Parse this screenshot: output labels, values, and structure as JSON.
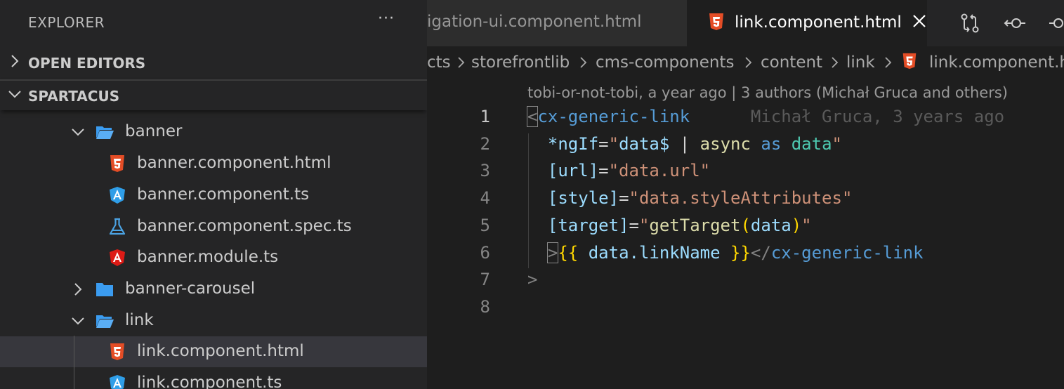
{
  "sidebar": {
    "title": "EXPLORER",
    "more": "···",
    "sections": {
      "open_editors": "OPEN EDITORS",
      "workspace": "SPARTACUS"
    },
    "tree": [
      {
        "label": "banner",
        "kind": "folder",
        "expanded": true
      },
      {
        "label": "banner.component.html",
        "kind": "html"
      },
      {
        "label": "banner.component.ts",
        "kind": "angular-component"
      },
      {
        "label": "banner.component.spec.ts",
        "kind": "test"
      },
      {
        "label": "banner.module.ts",
        "kind": "angular-module"
      },
      {
        "label": "banner-carousel",
        "kind": "folder",
        "expanded": false
      },
      {
        "label": "link",
        "kind": "folder",
        "expanded": true
      },
      {
        "label": "link.component.html",
        "kind": "html",
        "selected": true
      },
      {
        "label": "link.component.ts",
        "kind": "angular-component"
      }
    ]
  },
  "editor": {
    "tabs": [
      {
        "label": "igation-ui.component.html",
        "active": false
      },
      {
        "label": "link.component.html",
        "active": true
      }
    ],
    "tab_actions": [
      "open-changes-icon",
      "go-back-icon",
      "go-forward-icon"
    ],
    "breadcrumb": [
      "cts",
      "storefrontlib",
      "cms-components",
      "content",
      "link",
      "link.component.h"
    ],
    "codelens": "tobi-or-not-tobi, a year ago | 3 authors (Michał Gruca and others)",
    "line_numbers": [
      "1",
      "2",
      "3",
      "4",
      "5",
      "6",
      "7",
      "8"
    ],
    "lines": {
      "l1": {
        "bracket": "<",
        "tag": "cx-generic-link",
        "blame": "      Michał Gruca, 3 years ago"
      },
      "l2": {
        "indent": "  ",
        "attr": "*ngIf",
        "eq": "=",
        "q1": "\"",
        "v1": "data$",
        "pipe": " | ",
        "fn": "async",
        "kw": " as ",
        "var": "data",
        "q2": "\""
      },
      "l3": {
        "indent": "  ",
        "attr": "[url]",
        "eq": "=",
        "val": "\"data.url\""
      },
      "l4": {
        "indent": "  ",
        "attr": "[style]",
        "eq": "=",
        "val": "\"data.styleAttributes\""
      },
      "l5": {
        "indent": "  ",
        "attr": "[target]",
        "eq": "=",
        "q1": "\"",
        "fn": "getTarget",
        "p1": "(",
        "arg": "data",
        "p2": ")",
        "q2": "\""
      },
      "l6": {
        "indent": "  ",
        "gt": ">",
        "ob": "{{",
        "expr": " data.linkName ",
        "cb": "}}",
        "close": "</",
        "tag": "cx-generic-link"
      },
      "l7": {
        "gt": ">"
      },
      "l8": {}
    }
  },
  "colors": {
    "sidebar_bg": "#252526",
    "editor_bg": "#1e1e1e",
    "html_icon": "#e44d26",
    "angular_component_icon": "#2f9ee8",
    "angular_module_icon": "#dd1b16",
    "test_icon": "#4ba3e3",
    "folder_icon": "#3b9cf0"
  }
}
